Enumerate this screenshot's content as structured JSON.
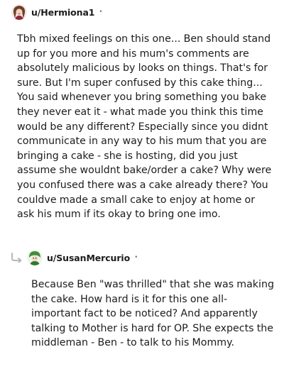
{
  "comments": [
    {
      "username": "u/Hermiona1",
      "separator": "•",
      "avatar_icon": "avatar-icon",
      "body": "Tbh mixed feelings on this one... Ben should stand up for you more and his mum's comments are absolutely malicious by looks on things. That's for sure. But I'm super confused by this cake thing... You said whenever you bring something you bake they never eat it - what made you think this time would be any different? Especially since you didnt communicate in any way to his mum that you are bringing a cake - she is hosting, did you just assume she wouldnt bake/order a cake? Why were you confused there was a cake already there? You couldve made a small cake to enjoy at home or ask his mum if its okay to bring one imo."
    },
    {
      "username": "u/SusanMercurio",
      "separator": "•",
      "avatar_icon": "avatar-icon",
      "reply_icon": "reply-arrow-icon",
      "body": "Because Ben \"was thrilled\" that she was making the cake. How hard is it for this one all-important fact to be noticed? And apparently talking to Mother is hard for OP. She expects the middleman - Ben - to talk to his Mommy."
    }
  ]
}
